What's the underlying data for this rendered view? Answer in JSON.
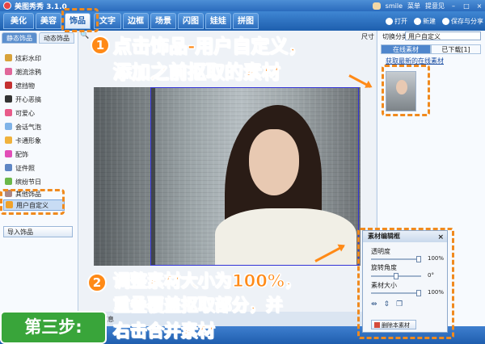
{
  "app": {
    "title": "美图秀秀 3.1.0",
    "user": "smile",
    "menu": "菜单",
    "feedback": "提意见"
  },
  "nav": {
    "tabs": [
      "美化",
      "美容",
      "饰品",
      "文字",
      "边框",
      "场景",
      "闪图",
      "娃娃",
      "拼图"
    ],
    "active_index": 2,
    "actions": {
      "open": "打开",
      "new": "新建",
      "save": "保存与分享"
    }
  },
  "left_panel": {
    "tabs": [
      "静态饰品",
      "动态饰品"
    ],
    "categories": [
      "炫彩水印",
      "潮流涂鸦",
      "遮挡物",
      "开心恶搞",
      "可爱心",
      "会话气泡",
      "卡通形象",
      "配饰",
      "证件照",
      "缤纷节日",
      "其他饰品",
      "用户自定义"
    ],
    "selected": "用户自定义",
    "import_button": "导入饰品"
  },
  "canvas": {
    "size_label": "尺寸",
    "status_text": "片信息"
  },
  "right_panel": {
    "category_label": "切换分类",
    "category_value": "用户自定义",
    "tabs": [
      "在线素材",
      "已下载[1]"
    ],
    "link": "获取最新的在线素材"
  },
  "editor": {
    "title": "素材编辑框",
    "opacity_label": "透明度",
    "opacity_value": "100%",
    "opacity": 1.0,
    "rotation_label": "旋转角度",
    "rotation_value": "0°",
    "rotation": 0.5,
    "size_label": "素材大小",
    "size_value": "100%",
    "size": 1.0,
    "delete_button": "删除本素材"
  },
  "annotations": {
    "step1_number": "1",
    "step1_line1": "点击饰品-用户自定义，",
    "step1_line2": "添加之前抠取的素材",
    "step2_number": "2",
    "step2_line1": "调整素材大小为100%，",
    "step2_line2": "重叠覆盖抠取部分，并",
    "step2_line3": "右击合并素材",
    "step_badge": "第三步:"
  },
  "colors": {
    "accent": "#ff8a17",
    "badge_green": "#39a53a",
    "nav_blue": "#2a6bbd"
  }
}
